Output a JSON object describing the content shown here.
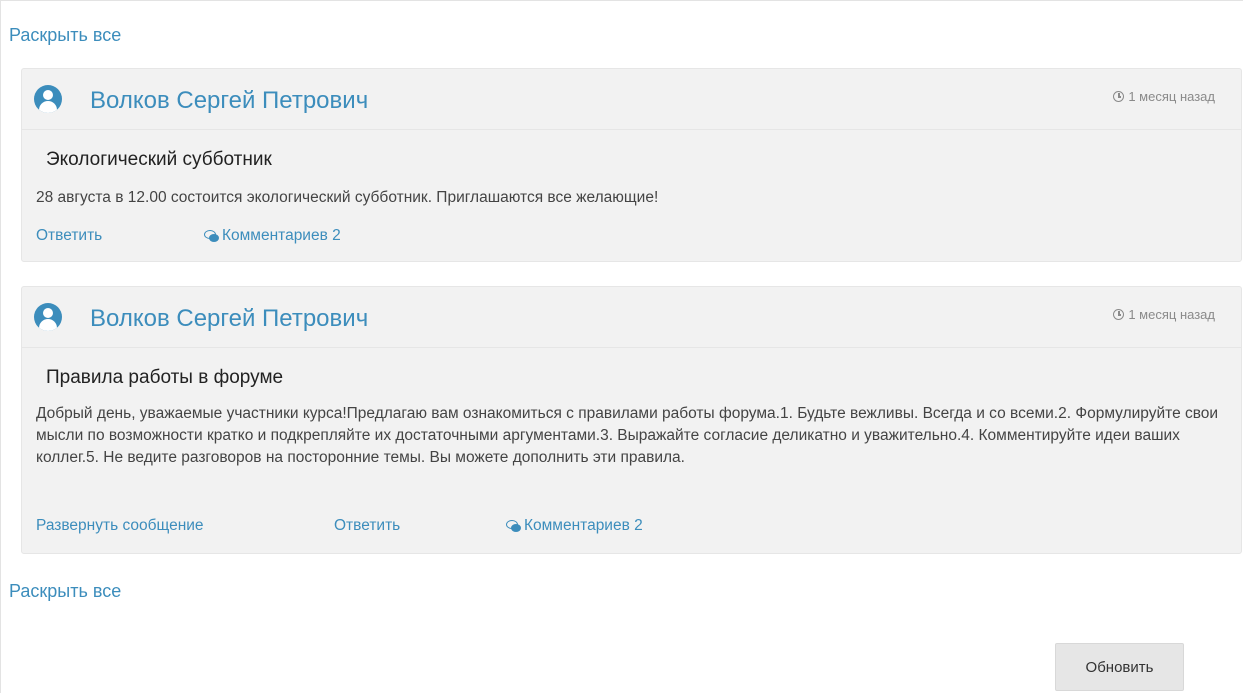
{
  "expand_all_label": "Раскрыть все",
  "posts": [
    {
      "author": "Волков Сергей Петрович",
      "timestamp": "1 месяц назад",
      "title": "Экологический субботник",
      "text": "28 августа в 12.00 состоится экологический субботник. Приглашаются все желающие!",
      "reply_label": "Ответить",
      "comments_label": "Комментариев 2"
    },
    {
      "author": "Волков Сергей Петрович",
      "timestamp": "1 месяц назад",
      "title": "Правила работы в форуме",
      "text": "Добрый день, уважаемые участники курса!Предлагаю вам ознакомиться с правилами работы форума.1. Будьте вежливы. Всегда и со всеми.2. Формулируйте свои мысли по возможности кратко и подкрепляйте их достаточными аргументами.3. Выражайте согласие деликатно и уважительно.4. Комментируйте идеи ваших коллег.5. Не ведите разговоров на посторонние темы. Вы можете дополнить эти правила.",
      "expand_label": "Развернуть сообщение",
      "reply_label": "Ответить",
      "comments_label": "Комментариев 2"
    }
  ],
  "refresh_label": "Обновить",
  "icons": {
    "avatar": "user-avatar-icon",
    "time": "clock-icon",
    "comments": "comments-icon"
  },
  "colors": {
    "link": "#3c8dbc",
    "panel": "#f2f2f2",
    "button": "#e6e6e6"
  }
}
